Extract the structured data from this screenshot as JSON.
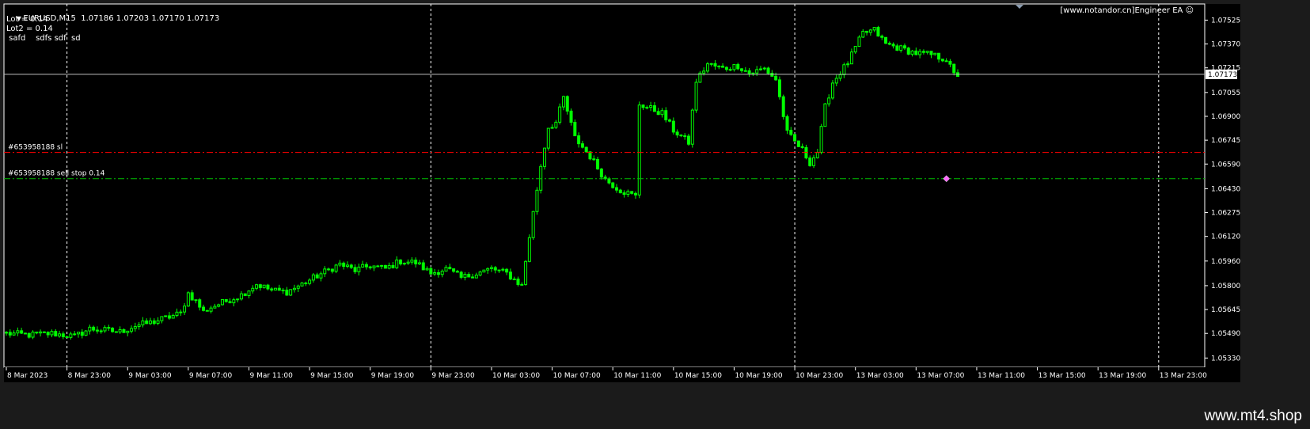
{
  "header": {
    "symbol_line": "EURUSD,M15  1.07186 1.07203 1.07170 1.07173",
    "lot": "Lot = 0.14",
    "lot2": "Lot2 = 0.14",
    "note": " safd    sdfs sdf  sd",
    "ea_label": "[www.notandor.cn]Engineer EA"
  },
  "watermark": "www.mt4.shop",
  "colors": {
    "background": "#000000",
    "frame": "#1b1b1b",
    "candle": "#00ff00",
    "axis_text": "#ffffff",
    "sl_line": "#ff0000",
    "order_line": "#00c000",
    "price_line": "#c0c0c0",
    "marker": "#ff66ff"
  },
  "chart_data": {
    "type": "candlestick",
    "symbol": "EURUSD",
    "timeframe": "M15",
    "ohlc_last": {
      "open": 1.07186,
      "high": 1.07203,
      "low": 1.0717,
      "close": 1.07173
    },
    "ylim": [
      1.0527,
      1.0763
    ],
    "y_ticks": [
      "1.07525",
      "1.07370",
      "1.07215",
      "1.07055",
      "1.06900",
      "1.06745",
      "1.06590",
      "1.06430",
      "1.06275",
      "1.06120",
      "1.05960",
      "1.05800",
      "1.05645",
      "1.05490",
      "1.05330"
    ],
    "x_ticks": [
      "8 Mar 2023",
      "8 Mar 23:00",
      "9 Mar 03:00",
      "9 Mar 07:00",
      "9 Mar 11:00",
      "9 Mar 15:00",
      "9 Mar 19:00",
      "9 Mar 23:00",
      "10 Mar 03:00",
      "10 Mar 07:00",
      "10 Mar 11:00",
      "10 Mar 15:00",
      "10 Mar 19:00",
      "10 Mar 23:00",
      "13 Mar 03:00",
      "13 Mar 07:00",
      "13 Mar 11:00",
      "13 Mar 15:00",
      "13 Mar 19:00",
      "13 Mar 23:00"
    ],
    "day_separators": [
      "8 Mar 23:00",
      "9 Mar 23:00",
      "10 Mar 23:00",
      "13 Mar 23:00"
    ],
    "close_path": [
      [
        0,
        1.0549
      ],
      [
        6,
        1.0548
      ],
      [
        12,
        1.0549
      ],
      [
        18,
        1.0547
      ],
      [
        22,
        1.0552
      ],
      [
        26,
        1.0551
      ],
      [
        30,
        1.055
      ],
      [
        34,
        1.0554
      ],
      [
        38,
        1.0556
      ],
      [
        42,
        1.0559
      ],
      [
        46,
        1.0562
      ],
      [
        48,
        1.0575
      ],
      [
        50,
        1.057
      ],
      [
        52,
        1.0563
      ],
      [
        54,
        1.0566
      ],
      [
        58,
        1.057
      ],
      [
        62,
        1.0574
      ],
      [
        66,
        1.0581
      ],
      [
        70,
        1.0577
      ],
      [
        74,
        1.0576
      ],
      [
        78,
        1.0581
      ],
      [
        84,
        1.0589
      ],
      [
        88,
        1.0594
      ],
      [
        92,
        1.059
      ],
      [
        96,
        1.0593
      ],
      [
        100,
        1.0591
      ],
      [
        104,
        1.0596
      ],
      [
        108,
        1.0595
      ],
      [
        112,
        1.0588
      ],
      [
        116,
        1.0591
      ],
      [
        120,
        1.0585
      ],
      [
        124,
        1.0588
      ],
      [
        128,
        1.0591
      ],
      [
        132,
        1.0588
      ],
      [
        136,
        1.058
      ],
      [
        138,
        1.0612
      ],
      [
        141,
        1.0658
      ],
      [
        143,
        1.0683
      ],
      [
        145,
        1.0686
      ],
      [
        147,
        1.0702
      ],
      [
        150,
        1.0676
      ],
      [
        154,
        1.0664
      ],
      [
        158,
        1.0649
      ],
      [
        162,
        1.0642
      ],
      [
        166,
        1.0638
      ],
      [
        167,
        1.0698
      ],
      [
        170,
        1.0695
      ],
      [
        173,
        1.0692
      ],
      [
        176,
        1.0681
      ],
      [
        180,
        1.0673
      ],
      [
        182,
        1.0713
      ],
      [
        185,
        1.0724
      ],
      [
        189,
        1.0721
      ],
      [
        193,
        1.0723
      ],
      [
        196,
        1.0718
      ],
      [
        200,
        1.0721
      ],
      [
        203,
        1.0714
      ],
      [
        206,
        1.0679
      ],
      [
        210,
        1.0668
      ],
      [
        212,
        1.066
      ],
      [
        214,
        1.0667
      ],
      [
        216,
        1.0696
      ],
      [
        218,
        1.0712
      ],
      [
        222,
        1.0725
      ],
      [
        226,
        1.0744
      ],
      [
        229,
        1.0746
      ],
      [
        232,
        1.0737
      ],
      [
        236,
        1.0734
      ],
      [
        240,
        1.0731
      ],
      [
        244,
        1.073
      ],
      [
        248,
        1.0727
      ],
      [
        250,
        1.0717
      ]
    ],
    "lines": [
      {
        "label": "#653958188 sl",
        "price": 1.06665
      },
      {
        "label": "#653958188 sell stop 0.14",
        "price": 1.06495
      }
    ],
    "current_price": "1.07173",
    "marker": {
      "bar": 248,
      "price": 1.06495
    }
  }
}
